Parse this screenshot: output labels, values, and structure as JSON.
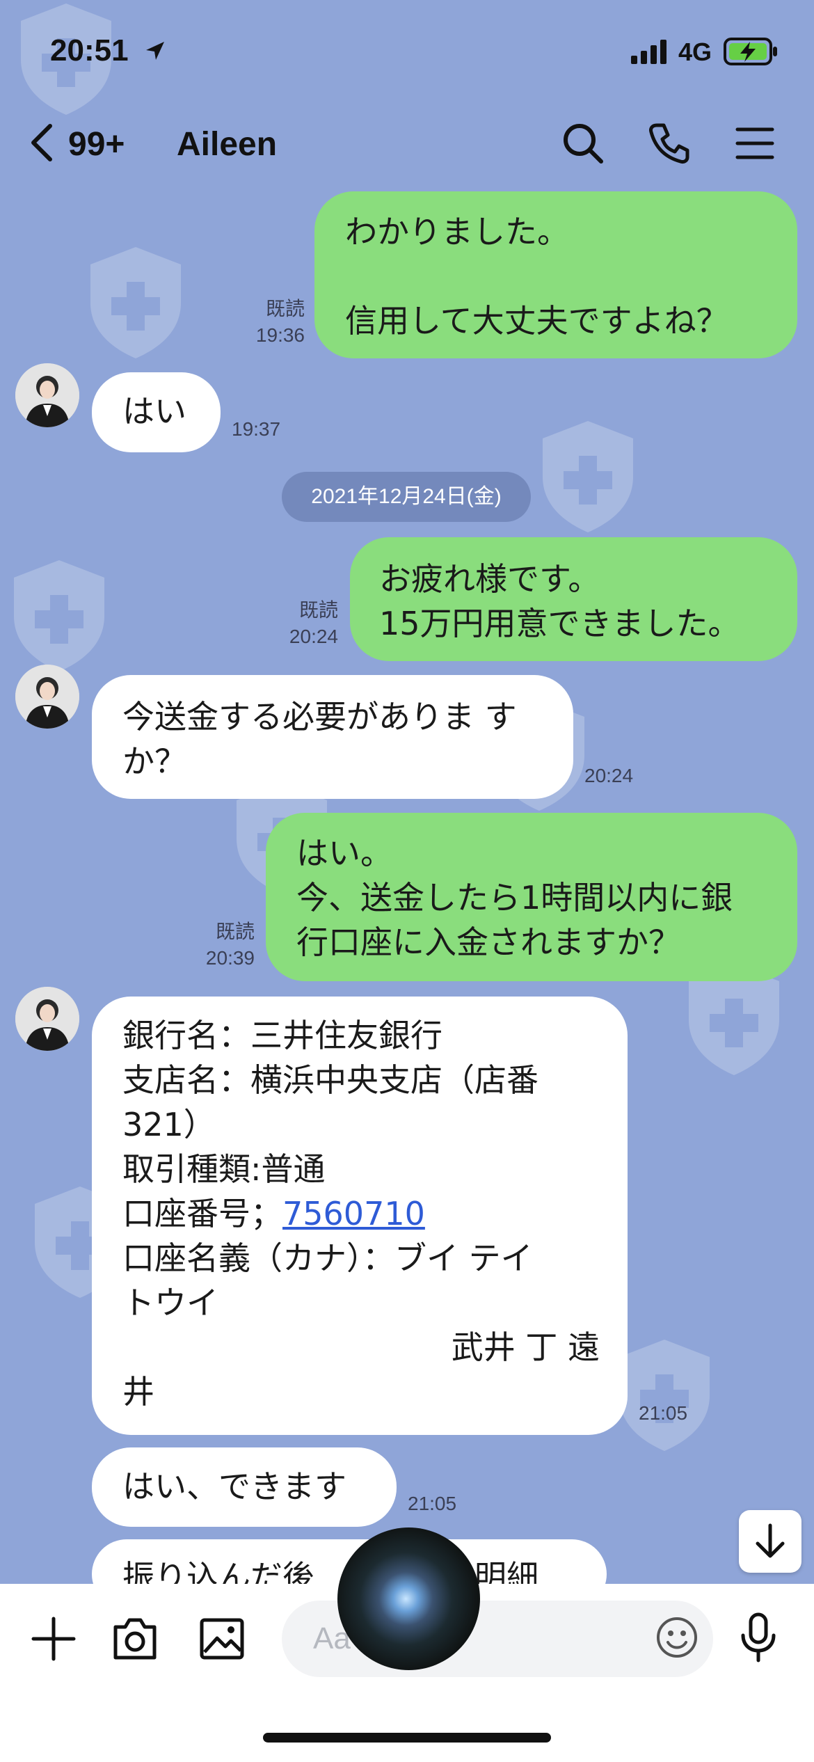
{
  "status_bar": {
    "time": "20:51",
    "network": "4G"
  },
  "header": {
    "back_count": "99+",
    "contact_name": "Aileen"
  },
  "messages": [
    {
      "side": "me",
      "lines": [
        "わかりました。",
        "",
        "信用して大丈夫ですよね？"
      ],
      "read": "既読",
      "time": "19:36"
    },
    {
      "side": "them",
      "lines": [
        "はい"
      ],
      "time": "19:37"
    },
    {
      "side": "date",
      "text": "2021年12月24日(金)"
    },
    {
      "side": "me",
      "lines": [
        "お疲れ様です。",
        "15万円用意できました。"
      ],
      "read": "既読",
      "time": "20:24"
    },
    {
      "side": "them",
      "lines": [
        "今送金する必要がありま す",
        "か？"
      ],
      "time": "20:24"
    },
    {
      "side": "me",
      "lines": [
        "はい。",
        "今、送金したら1時間以内に銀",
        "行口座に入金されますか？"
      ],
      "read": "既読",
      "time": "20:39"
    },
    {
      "side": "them",
      "lines": [
        "銀行名：三井住友銀行",
        "支店名：横浜中央支店（店番",
        "321）",
        "取引種類:普通",
        "口座番号；",
        "口座名義（カナ）：ブイ テイ",
        "トウイ",
        "武井 丁 遠",
        "井"
      ],
      "account_number": "7560710",
      "time": "21:05"
    },
    {
      "side": "them",
      "lines": [
        "はい、できます"
      ],
      "time": "21:05"
    },
    {
      "side": "them",
      "lines": [
        "振り込んだ後　　　　み明細"
      ]
    }
  ],
  "composer": {
    "placeholder": "Aa"
  },
  "icons": {
    "back": "chevron-left-icon",
    "search": "search-icon",
    "call": "phone-icon",
    "menu": "menu-icon",
    "add": "plus-icon",
    "camera": "camera-icon",
    "image": "image-icon",
    "emoji": "emoji-icon",
    "mic": "microphone-icon",
    "scroll": "arrow-down-icon",
    "location": "location-arrow-icon"
  },
  "colors": {
    "background": "#8FA5D8",
    "my_bubble": "#8ADD7D",
    "their_bubble": "#FFFFFF",
    "link": "#2E5BD6"
  }
}
